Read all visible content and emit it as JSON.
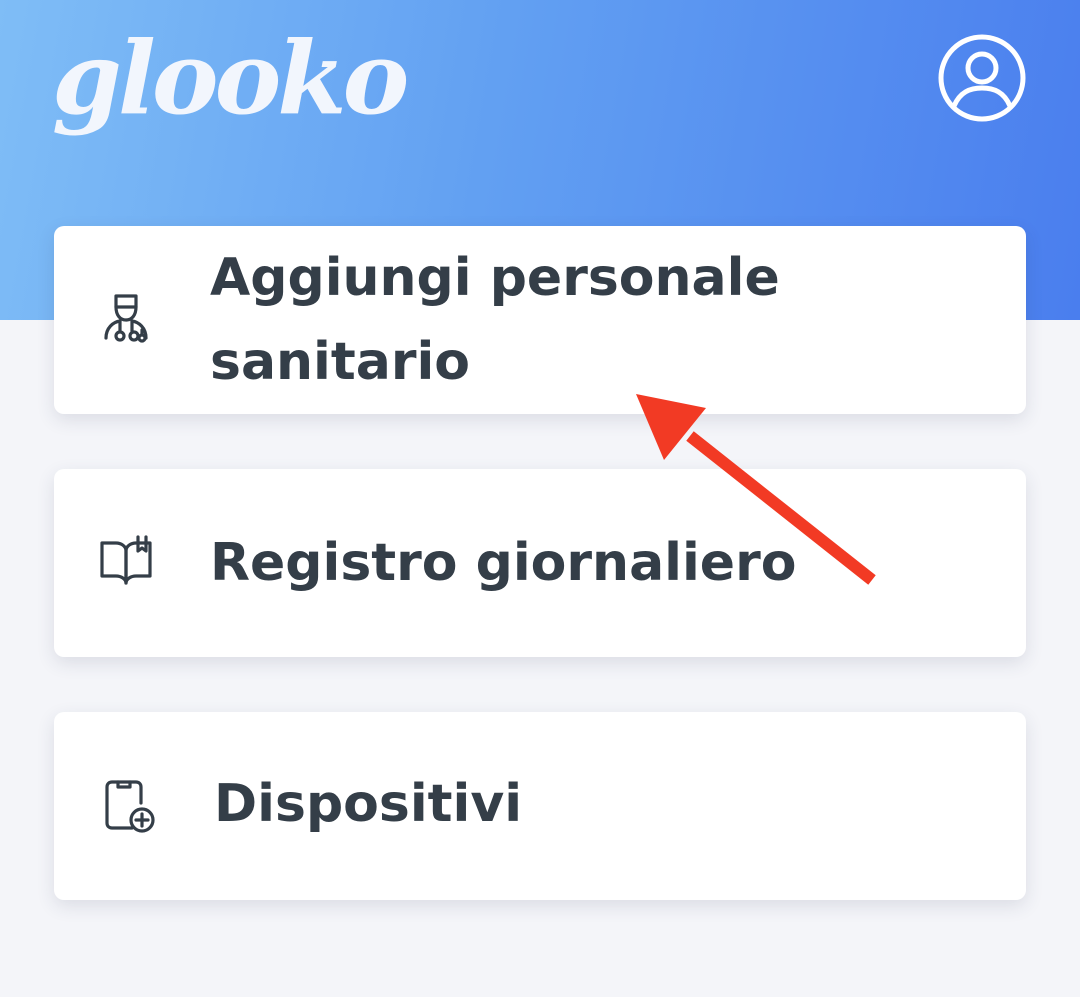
{
  "header": {
    "logo_text": "glooko",
    "profile_icon": "user-circle-icon",
    "gradient_colors": [
      "#7fbdf6",
      "#4a7eee"
    ]
  },
  "menu": {
    "items": [
      {
        "label": "Aggiungi personale sanitario",
        "icon": "doctor-icon"
      },
      {
        "label": "Registro giornaliero",
        "icon": "book-icon"
      },
      {
        "label": "Dispositivi",
        "icon": "device-add-icon"
      }
    ]
  },
  "annotation": {
    "arrow_color": "#f23a24"
  }
}
